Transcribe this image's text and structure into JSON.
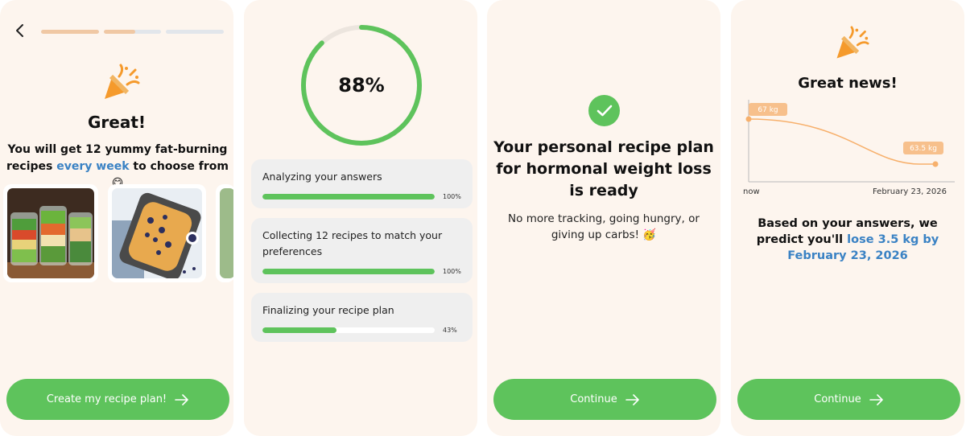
{
  "screen1": {
    "progress": [
      1,
      0.55,
      0
    ],
    "title": "Great!",
    "subtitle_before": "You will get 12 yummy fat-burning recipes ",
    "subtitle_highlight": "every week",
    "subtitle_after": " to choose from 😋",
    "cta_label": "Create my recipe plan!"
  },
  "screen2": {
    "overall_percent_label": "88%",
    "overall_progress": 0.88,
    "steps": [
      {
        "label": "Analyzing your answers",
        "percent_label": "100%",
        "progress": 1.0
      },
      {
        "label": "Collecting 12 recipes to match your preferences",
        "percent_label": "100%",
        "progress": 1.0
      },
      {
        "label": "Finalizing your recipe plan",
        "percent_label": "43%",
        "progress": 0.43
      }
    ]
  },
  "screen3": {
    "title": "Your personal recipe plan for hormonal weight loss is ready",
    "subtitle": "No more tracking, going hungry, or giving up carbs! 🥳",
    "cta_label": "Continue"
  },
  "screen4": {
    "title": "Great news!",
    "chart_data": {
      "type": "line",
      "x": [
        "now",
        "February 23, 2026"
      ],
      "values": [
        67,
        63.5
      ],
      "labels": [
        "67 kg",
        "63.5 kg"
      ]
    },
    "x_start_label": "now",
    "x_end_label": "February 23, 2026",
    "subtitle_before": "Based on your answers, we predict you'll ",
    "subtitle_highlight": "lose 3.5 kg by February 23, 2026",
    "cta_label": "Continue"
  },
  "colors": {
    "accent_green": "#5ec35c",
    "accent_orange": "#f5a25d",
    "highlight_blue": "#3a82c4",
    "background": "#fdf5ee"
  },
  "icons": {
    "back": "chevron-left-icon",
    "party": "party-popper-icon",
    "check": "check-icon",
    "arrow": "arrow-right-icon"
  }
}
